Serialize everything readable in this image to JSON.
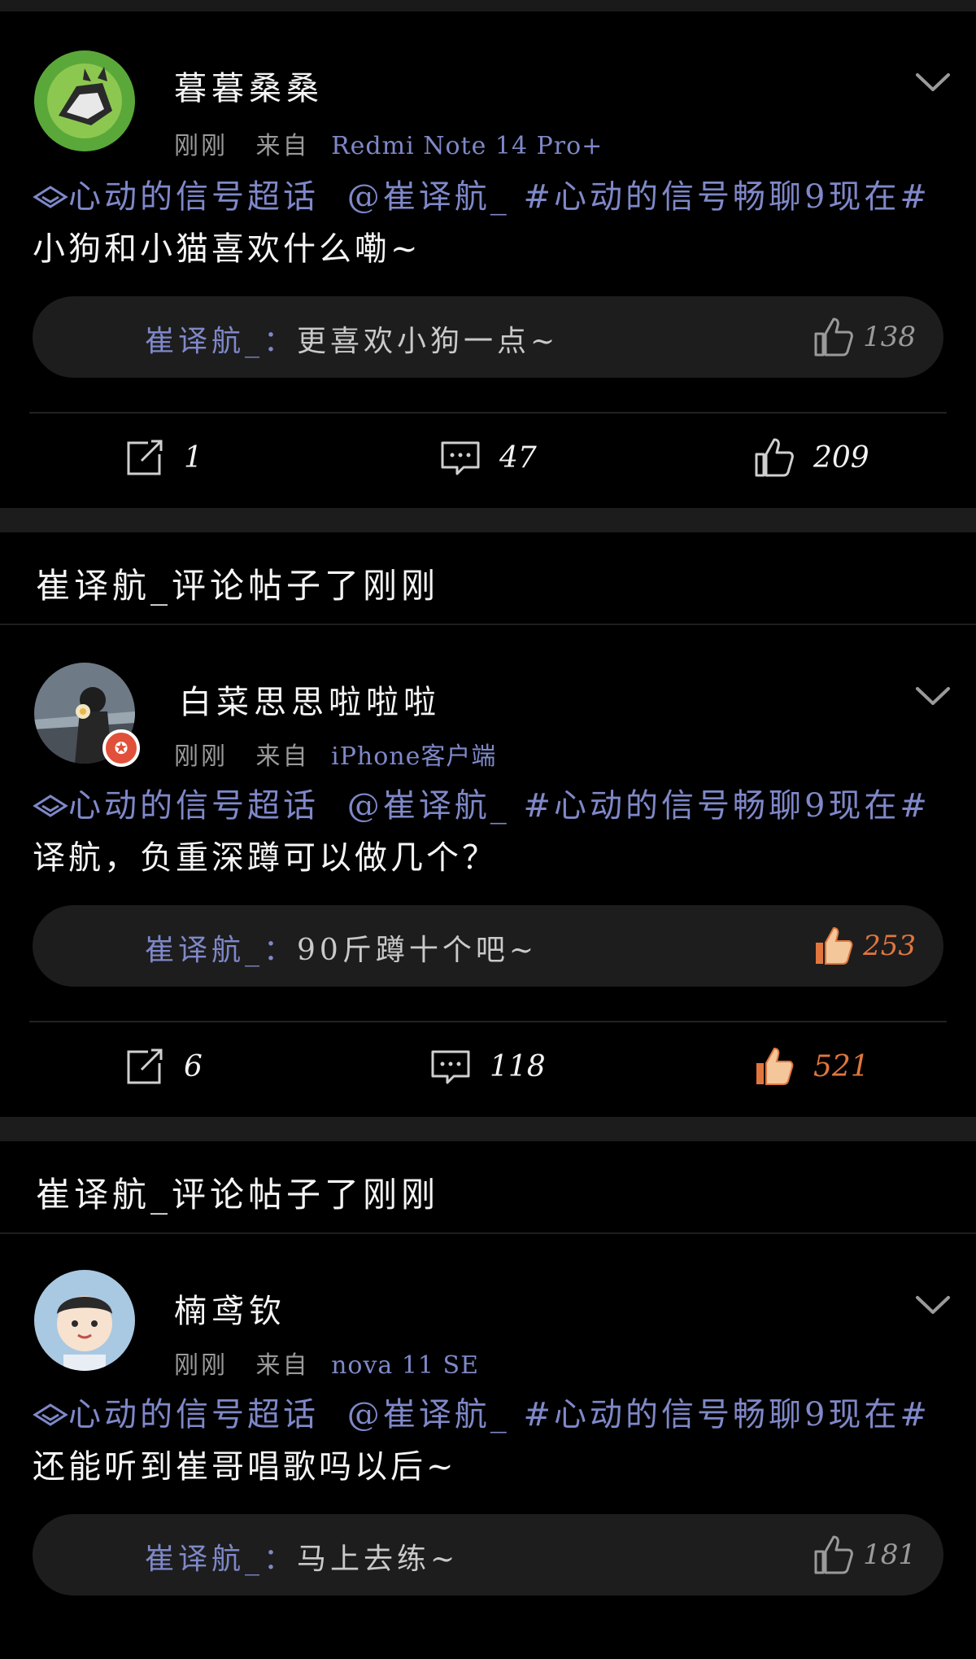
{
  "feed": {
    "activity_label": "崔译航_评论帖子了刚刚",
    "posts": [
      {
        "username": "暮暮桑桑",
        "time": "刚刚",
        "from_label": "来自",
        "device": "Redmi Note 14 Pro+",
        "topic_badge": "心动的信号超话",
        "mention": "@崔译航_",
        "hashtag": "#心动的信号畅聊9现在#",
        "content": "小狗和小猫喜欢什么嘞~",
        "reply_author": "崔译航_：",
        "reply_text": "更喜欢小狗一点~",
        "reply_likes": "138",
        "reposts": "1",
        "comments": "47",
        "likes": "209",
        "liked": false
      },
      {
        "username": "白菜思思啦啦啦",
        "time": "刚刚",
        "from_label": "来自",
        "device": "iPhone客户端",
        "topic_badge": "心动的信号超话",
        "mention": "@崔译航_",
        "hashtag": "#心动的信号畅聊9现在#",
        "content": " 译航，负重深蹲可以做几个？",
        "reply_author": "崔译航_：",
        "reply_text": "90斤蹲十个吧~",
        "reply_likes": "253",
        "reposts": "6",
        "comments": "118",
        "likes": "521",
        "liked": true
      },
      {
        "username": "楠鸢钦",
        "time": "刚刚",
        "from_label": "来自",
        "device": "nova 11 SE",
        "topic_badge": "心动的信号超话",
        "mention": "@崔译航_",
        "hashtag": "#心动的信号畅聊9现在#",
        "content": "还能听到崔哥唱歌吗以后~",
        "reply_author": "崔译航_：",
        "reply_text": "马上去练~",
        "reply_likes": "181"
      }
    ]
  },
  "colors": {
    "accent": "#7f88c8",
    "liked": "#e0763e",
    "background": "#000000"
  },
  "icons": [
    "chevron-down-icon",
    "super-topic-diamond-icon",
    "thumb-up-icon",
    "repost-icon",
    "comment-icon",
    "verified-badge-icon"
  ]
}
